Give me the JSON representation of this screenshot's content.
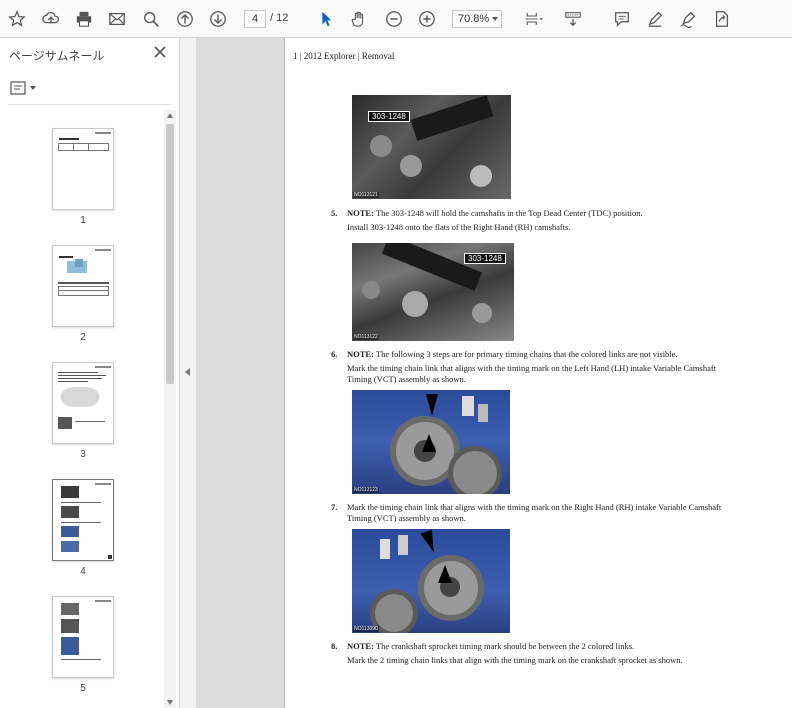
{
  "toolbar": {
    "page_current": "4",
    "page_total": "/ 12",
    "zoom": "70.8%"
  },
  "sidebar": {
    "title": "ページサムネール",
    "thumbnails": [
      {
        "label": "1"
      },
      {
        "label": "2"
      },
      {
        "label": "3"
      },
      {
        "label": "4"
      },
      {
        "label": "5"
      }
    ]
  },
  "document": {
    "header": "1 | 2012 Explorer | Removal",
    "photos": [
      {
        "tag": "303-1248",
        "caption": "NO113121"
      },
      {
        "tag": "303-1248",
        "caption": "NO113122"
      },
      {
        "tag": "",
        "caption": "NO113123"
      },
      {
        "tag": "",
        "caption": "NO113090"
      }
    ],
    "steps": [
      {
        "num": "5.",
        "lead": "NOTE:",
        "text": " The 303-1248 will hold the camshafts in the Top Dead Center (TDC) position.",
        "sub": "Install 303-1248 onto the flats of the Right Hand (RH) camshafts."
      },
      {
        "num": "6.",
        "lead": "NOTE:",
        "text": " The following 3 steps are for primary timing chains that the colored links are not visible.",
        "sub": "Mark the timing chain link that aligns with the timing mark on the Left Hand (LH) intake Variable Camshaft Timing (VCT) assembly as shown."
      },
      {
        "num": "7.",
        "lead": "",
        "text": "Mark the timing chain link that aligns with the timing mark on the Right Hand (RH) intake Variable Camshaft Timing (VCT) assembly as shown.",
        "sub": ""
      },
      {
        "num": "8.",
        "lead": "NOTE:",
        "text": " The crankshaft sprocket timing mark should be between the 2 colored links.",
        "sub": "Mark the 2 timing chain links that align with the timing mark on the crankshaft sprocket as shown."
      }
    ]
  },
  "colors": {
    "accent": "#0a64c8",
    "toolbar_bg": "#fafafa",
    "doc_bg": "#dcdcdc"
  }
}
